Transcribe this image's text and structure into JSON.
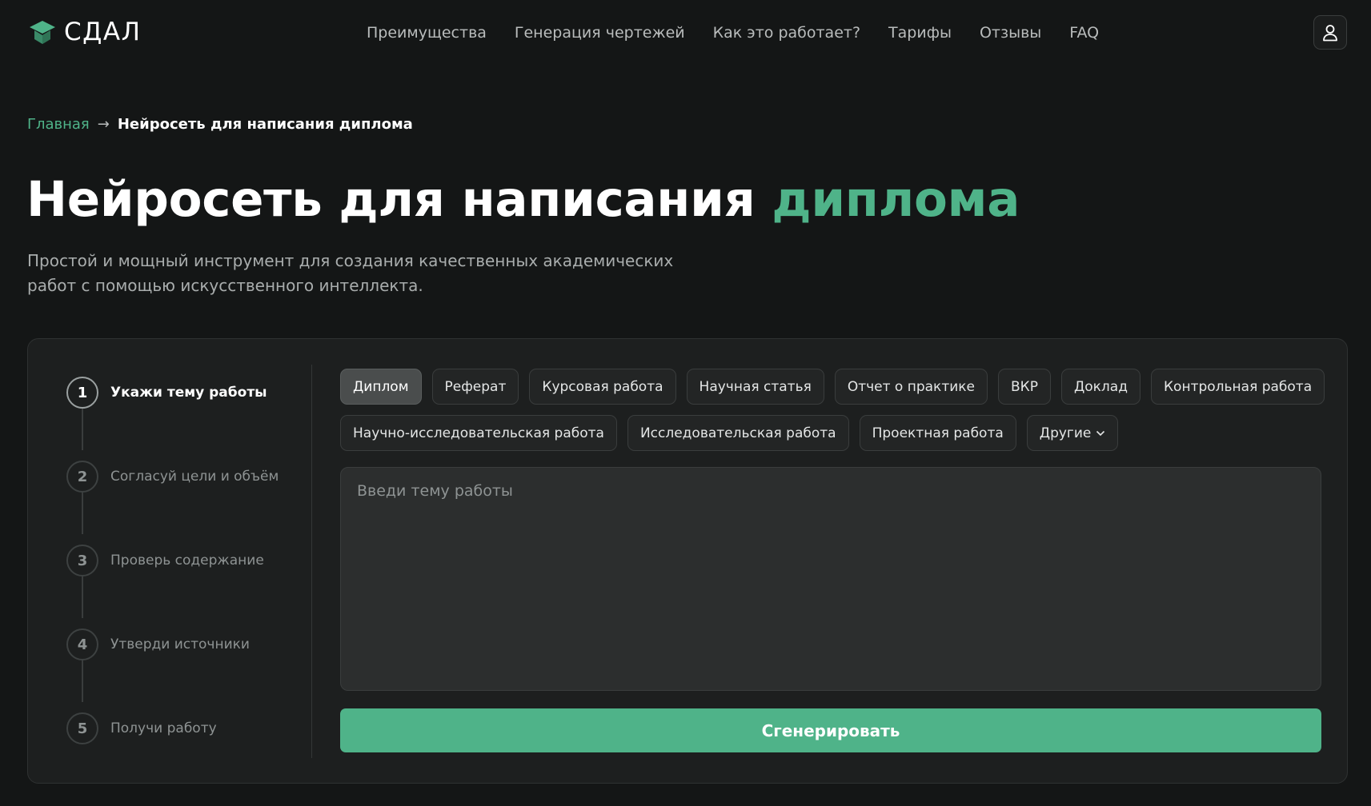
{
  "brand": {
    "name": "СДАЛ",
    "accent_color": "#4fb389"
  },
  "nav": {
    "items": [
      {
        "label": "Преимущества"
      },
      {
        "label": "Генерация чертежей"
      },
      {
        "label": "Как это работает?"
      },
      {
        "label": "Тарифы"
      },
      {
        "label": "Отзывы"
      },
      {
        "label": "FAQ"
      }
    ],
    "user_icon": "user-icon"
  },
  "breadcrumb": {
    "home": "Главная",
    "separator": "→",
    "current": "Нейросеть для написания диплома"
  },
  "hero": {
    "title_main": "Нейросеть для написания ",
    "title_accent": "диплома",
    "subtitle_line1": "Простой и мощный инструмент для создания качественных академических",
    "subtitle_line2": "работ с помощью искусственного интеллекта."
  },
  "steps": [
    {
      "num": "1",
      "label": "Укажи тему работы",
      "active": true
    },
    {
      "num": "2",
      "label": "Согласуй цели и объём",
      "active": false
    },
    {
      "num": "3",
      "label": "Проверь содержание",
      "active": false
    },
    {
      "num": "4",
      "label": "Утверди источники",
      "active": false
    },
    {
      "num": "5",
      "label": "Получи работу",
      "active": false
    }
  ],
  "work_types": {
    "row1": [
      "Диплом",
      "Реферат",
      "Курсовая работа",
      "Научная статья",
      "Отчет о практике",
      "ВКР",
      "Доклад",
      "Контрольная работа"
    ],
    "row2": [
      "Научно-исследовательская работа",
      "Исследовательская работа",
      "Проектная работа"
    ],
    "other_label": "Другие",
    "selected": "Диплом"
  },
  "topic": {
    "placeholder": "Введи тему работы",
    "value": ""
  },
  "generate_button": "Сгенерировать"
}
